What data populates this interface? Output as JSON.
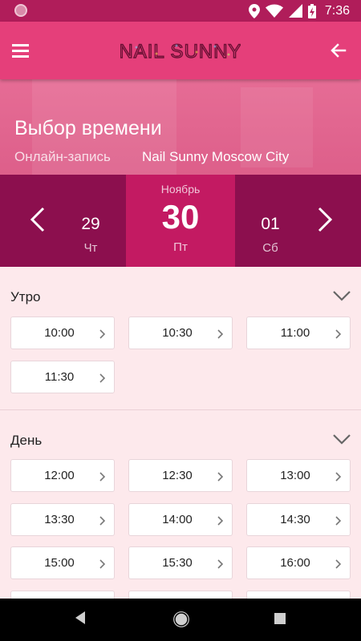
{
  "status_bar": {
    "time": "7:36"
  },
  "app_bar": {
    "logo_text": "NAIL SUNNY"
  },
  "hero": {
    "title": "Выбор времени",
    "subtitle_label": "Онлайн-запись",
    "salon_name": "Nail Sunny Moscow City"
  },
  "date_picker": {
    "month": "Ноябрь",
    "prev": {
      "day": "29",
      "weekday": "Чт"
    },
    "current": {
      "day": "30",
      "weekday": "Пт"
    },
    "next": {
      "day": "01",
      "weekday": "Сб"
    }
  },
  "sections": [
    {
      "title": "Утро",
      "slots": [
        "10:00",
        "10:30",
        "11:00",
        "11:30"
      ]
    },
    {
      "title": "День",
      "slots": [
        "12:00",
        "12:30",
        "13:00",
        "13:30",
        "14:00",
        "14:30",
        "15:00",
        "15:30",
        "16:00"
      ]
    }
  ],
  "colors": {
    "status_bar": "#b01d5a",
    "app_bar": "#e53f7a",
    "date_strip": "#8c0f4e",
    "date_selected": "#c31a62",
    "background": "#fde9ec"
  }
}
